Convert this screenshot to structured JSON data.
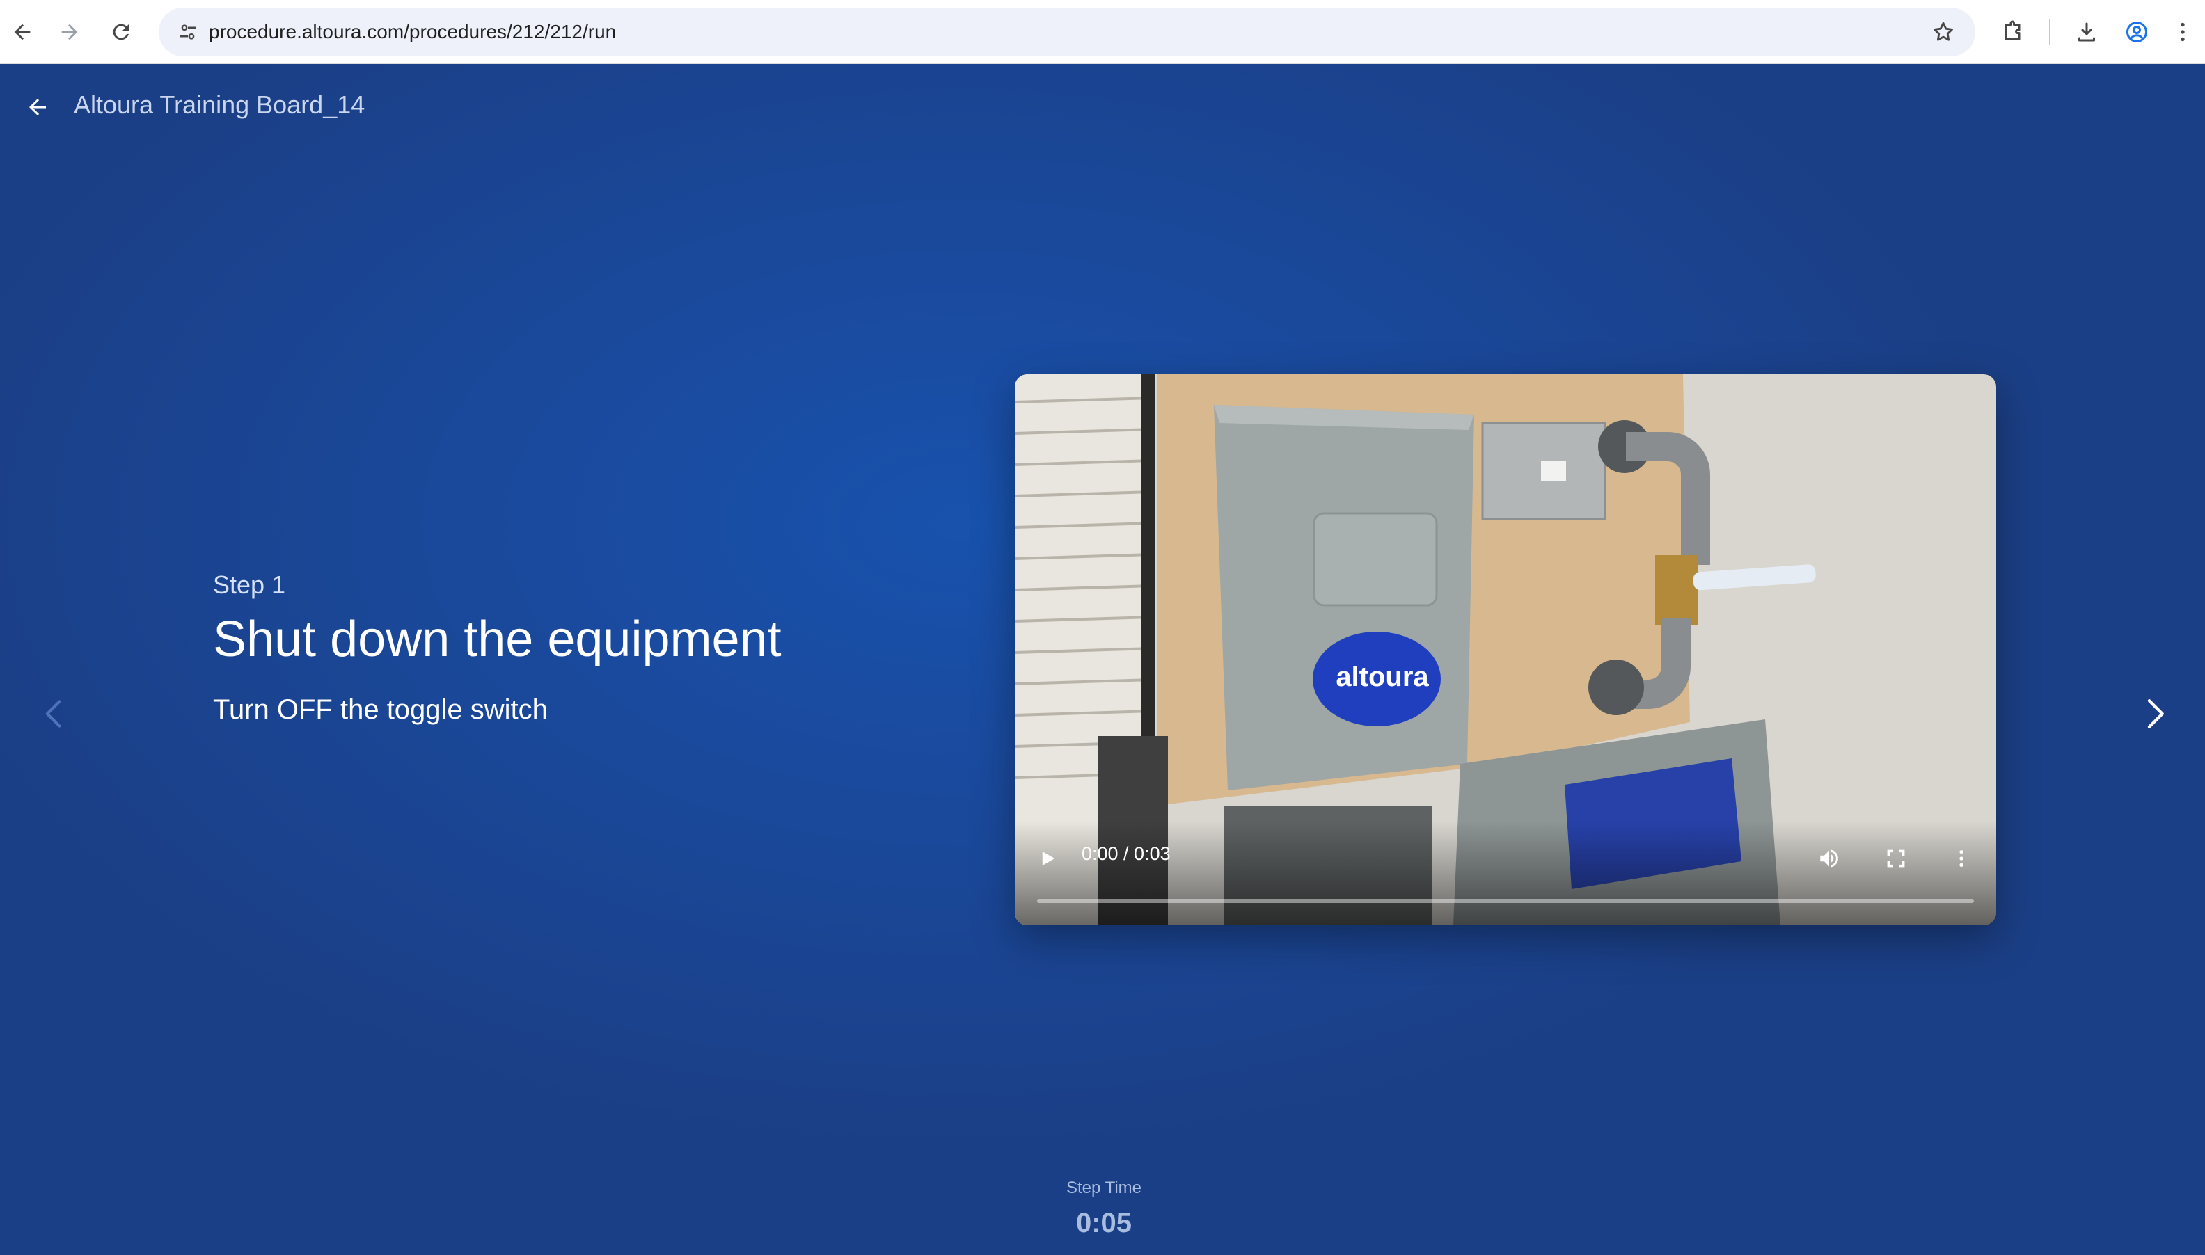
{
  "browser": {
    "url": "procedure.altoura.com/procedures/212/212/run",
    "icons": {
      "back": "arrow-left-icon",
      "forward": "arrow-right-icon",
      "reload": "reload-icon",
      "site_info": "tune-icon",
      "bookmark": "star-icon",
      "extensions": "puzzle-icon",
      "downloads": "download-icon",
      "profile": "account-circle-icon",
      "menu": "kebab-menu-icon"
    }
  },
  "header": {
    "title": "Altoura Training Board_14"
  },
  "step": {
    "label": "Step 1",
    "title": "Shut down the equipment",
    "description": "Turn OFF the toggle switch"
  },
  "video": {
    "time": "0:00 / 0:03",
    "progress": 0,
    "logo_text": "altoura"
  },
  "timer": {
    "label": "Step Time",
    "value": "0:05"
  },
  "colors": {
    "background": "#1a4a9e",
    "accent_text": "#a9bde0",
    "white": "#ffffff"
  }
}
